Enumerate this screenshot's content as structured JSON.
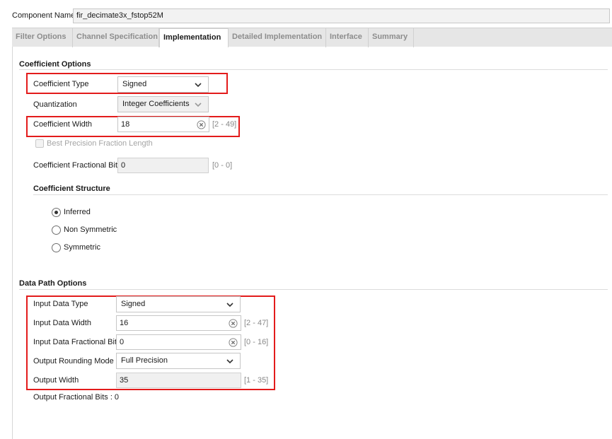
{
  "component": {
    "label": "Component Name",
    "value": "fir_decimate3x_fstop52M"
  },
  "tabs": [
    {
      "label": "Filter Options",
      "active": false
    },
    {
      "label": "Channel Specification",
      "active": false
    },
    {
      "label": "Implementation",
      "active": true
    },
    {
      "label": "Detailed Implementation",
      "active": false
    },
    {
      "label": "Interface",
      "active": false
    },
    {
      "label": "Summary",
      "active": false
    }
  ],
  "coefficient_options": {
    "title": "Coefficient Options",
    "coefficient_type": {
      "label": "Coefficient Type",
      "value": "Signed"
    },
    "quantization": {
      "label": "Quantization",
      "value": "Integer Coefficients"
    },
    "coefficient_width": {
      "label": "Coefficient Width",
      "value": "18",
      "range": "[2 - 49]"
    },
    "best_precision": {
      "label": "Best Precision Fraction Length",
      "checked": false
    },
    "fractional_bits": {
      "label": "Coefficient Fractional Bits",
      "value": "0",
      "range": "[0 - 0]"
    },
    "structure": {
      "title": "Coefficient Structure",
      "options": [
        {
          "label": "Inferred",
          "selected": true
        },
        {
          "label": "Non Symmetric",
          "selected": false
        },
        {
          "label": "Symmetric",
          "selected": false
        }
      ]
    }
  },
  "data_path_options": {
    "title": "Data Path Options",
    "input_data_type": {
      "label": "Input Data Type",
      "value": "Signed"
    },
    "input_data_width": {
      "label": "Input Data Width",
      "value": "16",
      "range": "[2 - 47]"
    },
    "input_fractional_bits": {
      "label": "Input Data Fractional Bits",
      "value": "0",
      "range": "[0 - 16]"
    },
    "output_rounding_mode": {
      "label": "Output Rounding Mode",
      "value": "Full Precision"
    },
    "output_width": {
      "label": "Output Width",
      "value": "35",
      "range": "[1 - 35]"
    },
    "output_fractional_bits": "Output Fractional Bits : 0"
  },
  "colors": {
    "highlight": "#e31b1b",
    "tabbar": "#e6e6e6"
  }
}
